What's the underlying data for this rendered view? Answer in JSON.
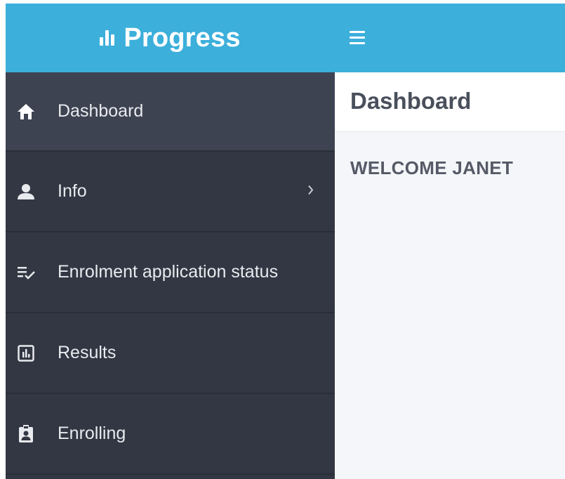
{
  "brand": {
    "name": "Progress",
    "icon": "bar-chart-icon"
  },
  "topbar": {
    "menu_icon": "hamburger-icon"
  },
  "sidebar": {
    "items": [
      {
        "label": "Dashboard",
        "icon": "home-icon",
        "active": true
      },
      {
        "label": "Info",
        "icon": "user-icon",
        "has_submenu": true
      },
      {
        "label": "Enrolment application status",
        "icon": "checklist-icon"
      },
      {
        "label": "Results",
        "icon": "chart-box-icon"
      },
      {
        "label": "Enrolling",
        "icon": "clipboard-user-icon"
      }
    ]
  },
  "main": {
    "title": "Dashboard",
    "welcome": "WELCOME JANET"
  },
  "colors": {
    "header": "#3cafdb",
    "sidebar": "#333743",
    "sidebar_active": "#3e4352",
    "content_bg": "#f4f6f9"
  }
}
